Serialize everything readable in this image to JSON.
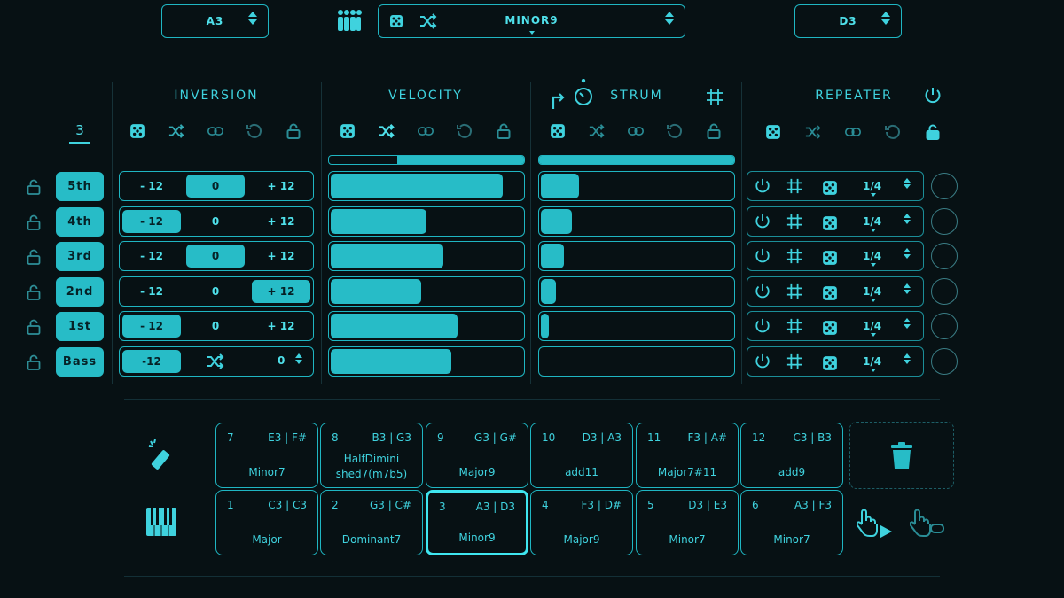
{
  "top": {
    "left_select": "A3",
    "chord_select": "MINOR9",
    "right_select": "D3"
  },
  "sections": {
    "inversion": "INVERSION",
    "velocity": "VELOCITY",
    "strum": "STRUM",
    "repeater": "REPEATER"
  },
  "voice_count": "3",
  "notes": [
    {
      "label": "5th",
      "inv_left": "- 12",
      "inv_mid": "0",
      "inv_right": "+ 12",
      "inv_on": "mid",
      "velocity": 0.9,
      "strum": 0.2
    },
    {
      "label": "4th",
      "inv_left": "- 12",
      "inv_mid": "0",
      "inv_right": "+ 12",
      "inv_on": "left",
      "velocity": 0.5,
      "strum": 0.16
    },
    {
      "label": "3rd",
      "inv_left": "- 12",
      "inv_mid": "0",
      "inv_right": "+ 12",
      "inv_on": "mid",
      "velocity": 0.59,
      "strum": 0.12
    },
    {
      "label": "2nd",
      "inv_left": "- 12",
      "inv_mid": "0",
      "inv_right": "+ 12",
      "inv_on": "right",
      "velocity": 0.47,
      "strum": 0.08
    },
    {
      "label": "1st",
      "inv_left": "- 12",
      "inv_mid": "0",
      "inv_right": "+ 12",
      "inv_on": "left",
      "velocity": 0.66,
      "strum": 0.04
    },
    {
      "label": "Bass",
      "inv_left": "-12",
      "inv_right": "0",
      "inv_on": "left",
      "velocity": 0.63,
      "strum": 0.0
    }
  ],
  "velocity_master": 0.35,
  "strum_master": 1.0,
  "repeater_value": "1/4",
  "pads_top": [
    {
      "num": "7",
      "notes": "E3 | F#",
      "name": "Minor7"
    },
    {
      "num": "8",
      "notes": "B3 | G3",
      "name": "HalfDimini shed7(m7b5)"
    },
    {
      "num": "9",
      "notes": "G3 | G#",
      "name": "Major9"
    },
    {
      "num": "10",
      "notes": "D3 | A3",
      "name": "add11"
    },
    {
      "num": "11",
      "notes": "F3 | A#",
      "name": "Major7#11"
    },
    {
      "num": "12",
      "notes": "C3 | B3",
      "name": "add9"
    }
  ],
  "pads_bottom": [
    {
      "num": "1",
      "notes": "C3 | C3",
      "name": "Major"
    },
    {
      "num": "2",
      "notes": "G3 | C#",
      "name": "Dominant7"
    },
    {
      "num": "3",
      "notes": "A3 | D3",
      "name": "Minor9"
    },
    {
      "num": "4",
      "notes": "F3 | D#",
      "name": "Major9"
    },
    {
      "num": "5",
      "notes": "D3 | E3",
      "name": "Minor7"
    },
    {
      "num": "6",
      "notes": "A3 | F3",
      "name": "Minor7"
    }
  ],
  "active_pad": "3",
  "colors": {
    "accent": "#27bcc7",
    "background": "#071114"
  }
}
